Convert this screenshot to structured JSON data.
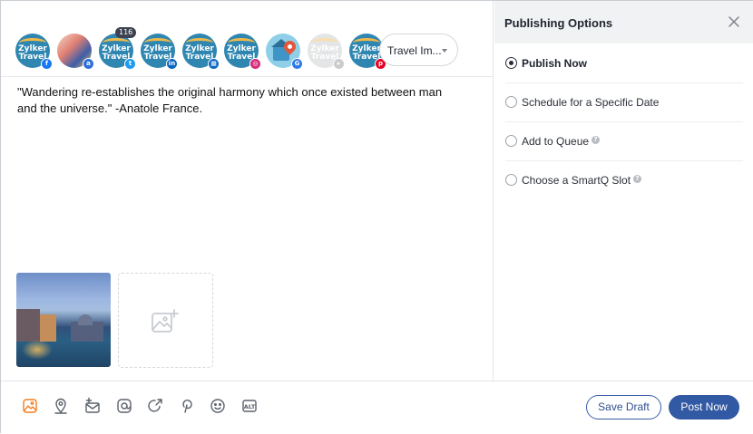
{
  "composer": {
    "accounts": [
      {
        "name_line1": "Zylker",
        "name_line2": "Travel",
        "network": "facebook",
        "badge_icon": "facebook-icon",
        "badge_glyph": "f",
        "badge_color": "#1877f2",
        "avatar": "logo"
      },
      {
        "name_line1": "",
        "name_line2": "",
        "network": "adobe-bridge",
        "badge_icon": "network-badge-icon",
        "badge_glyph": "a",
        "badge_color": "#2e6fd9",
        "avatar": "photo"
      },
      {
        "name_line1": "Zylker",
        "name_line2": "Travel",
        "network": "twitter",
        "badge_icon": "twitter-icon",
        "badge_glyph": "t",
        "badge_color": "#1d9bf0",
        "avatar": "logo",
        "count": "116"
      },
      {
        "name_line1": "Zylker",
        "name_line2": "Travel",
        "network": "linkedin",
        "badge_icon": "linkedin-icon",
        "badge_glyph": "in",
        "badge_color": "#0a66c2",
        "avatar": "logo"
      },
      {
        "name_line1": "Zylker",
        "name_line2": "Travel",
        "network": "linkedin-page",
        "badge_icon": "building-icon",
        "badge_glyph": "▦",
        "badge_color": "#0a66c2",
        "avatar": "logo"
      },
      {
        "name_line1": "Zylker",
        "name_line2": "Travel",
        "network": "instagram",
        "badge_icon": "instagram-icon",
        "badge_glyph": "◎",
        "badge_color": "#d6297a",
        "avatar": "logo"
      },
      {
        "name_line1": "",
        "name_line2": "",
        "network": "google-business",
        "badge_icon": "google-icon",
        "badge_glyph": "G",
        "badge_color": "#2f7ae5",
        "avatar": "map"
      },
      {
        "name_line1": "Zylker",
        "name_line2": "Travel",
        "network": "youtube",
        "badge_icon": "youtube-icon",
        "badge_glyph": "▸",
        "badge_color": "#8d8f93",
        "avatar": "logo",
        "faded": true
      },
      {
        "name_line1": "Zylker",
        "name_line2": "Travel",
        "network": "pinterest",
        "badge_icon": "pinterest-icon",
        "badge_glyph": "p",
        "badge_color": "#e60023",
        "avatar": "logo"
      }
    ],
    "group_select": {
      "label": "Travel Im..."
    },
    "post_text": "\"Wandering re-establishes the original harmony which once existed between man and the universe.\"  -Anatole France."
  },
  "panel": {
    "title": "Publishing Options",
    "options": [
      {
        "label": "Publish Now",
        "selected": true,
        "help": false
      },
      {
        "label": "Schedule for a Specific Date",
        "selected": false,
        "help": false
      },
      {
        "label": "Add to Queue",
        "selected": false,
        "help": true
      },
      {
        "label": "Choose a SmartQ Slot",
        "selected": false,
        "help": true
      }
    ],
    "help_glyph": "?"
  },
  "footer": {
    "tools": [
      {
        "name": "image-icon",
        "color": "#f07d22"
      },
      {
        "name": "location-icon",
        "color": "#5b616b"
      },
      {
        "name": "mail-add-icon",
        "color": "#5b616b"
      },
      {
        "name": "mention-icon",
        "color": "#5b616b"
      },
      {
        "name": "share-icon",
        "color": "#5b616b"
      },
      {
        "name": "pinterest-icon",
        "color": "#5b616b"
      },
      {
        "name": "emoji-icon",
        "color": "#5b616b"
      },
      {
        "name": "alt-text-icon",
        "color": "#5b616b",
        "text": "ALT"
      }
    ],
    "save_draft_label": "Save Draft",
    "post_now_label": "Post Now"
  },
  "colors": {
    "primary": "#3259a3",
    "accent": "#f07d22"
  }
}
